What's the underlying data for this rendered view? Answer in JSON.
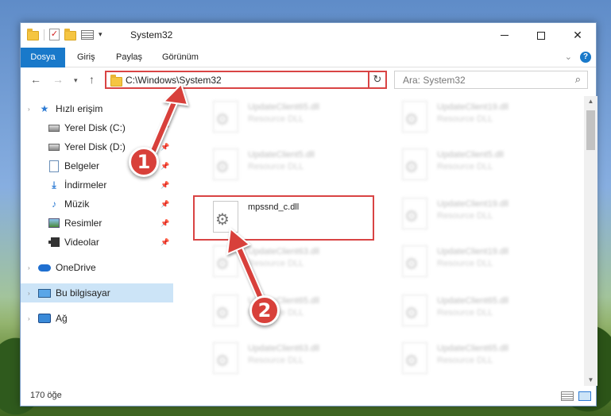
{
  "window": {
    "title": "System32"
  },
  "ribbon": {
    "tabs": [
      {
        "label": "Dosya"
      },
      {
        "label": "Giriş"
      },
      {
        "label": "Paylaş"
      },
      {
        "label": "Görünüm"
      }
    ],
    "help": "?"
  },
  "address": {
    "path": "C:\\Windows\\System32",
    "search_placeholder": "Ara: System32"
  },
  "sidebar": {
    "quick_access": "Hızlı erişim",
    "items": [
      {
        "label": "Yerel Disk (C:)"
      },
      {
        "label": "Yerel Disk (D:)"
      },
      {
        "label": "Belgeler"
      },
      {
        "label": "İndirmeler"
      },
      {
        "label": "Müzik"
      },
      {
        "label": "Resimler"
      },
      {
        "label": "Videolar"
      }
    ],
    "onedrive": "OneDrive",
    "this_pc": "Bu bilgisayar",
    "network": "Ağ"
  },
  "files": {
    "left_column": [
      {
        "name": "UpdateClient65.dll",
        "type": "Resource DLL"
      },
      {
        "name": "UpdateClient5.dll",
        "type": "Resource DLL"
      },
      {
        "name": "mpssnd_c.dll",
        "type": ""
      },
      {
        "name": "UpdateClient63.dll",
        "type": "Resource DLL"
      },
      {
        "name": "UpdateClient65.dll",
        "type": "Resource DLL"
      },
      {
        "name": "UpdateClient63.dll",
        "type": "Resource DLL"
      }
    ],
    "right_column": [
      {
        "name": "UpdateClient19.dll",
        "type": "Resource DLL"
      },
      {
        "name": "UpdateClient5.dll",
        "type": "Resource DLL"
      },
      {
        "name": "UpdateClient19.dll",
        "type": "Resource DLL"
      },
      {
        "name": "UpdateClient19.dll",
        "type": "Resource DLL"
      },
      {
        "name": "UpdateClient65.dll",
        "type": "Resource DLL"
      },
      {
        "name": "UpdateClient65.dll",
        "type": "Resource DLL"
      }
    ]
  },
  "status": {
    "item_count": "170 öğe"
  },
  "annotations": {
    "step1": "1",
    "step2": "2"
  },
  "colors": {
    "accent": "#1979ca",
    "highlight": "#d94444",
    "callout": "#d8403a"
  }
}
